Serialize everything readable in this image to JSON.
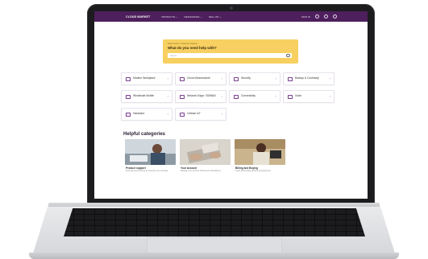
{
  "nav": {
    "brand": "CLOUD MARKET",
    "links": [
      "PRODUCTS ⌄",
      "RESOURCES ⌄",
      "SELL ON ⌄"
    ],
    "login": "SIGN IN"
  },
  "banner": {
    "crumb": "Help Center / Customer Support",
    "title": "What do you need help with?",
    "placeholder": "Search"
  },
  "categories": [
    {
      "label": "Modern Workplace"
    },
    {
      "label": "Cloud Infrastructure"
    },
    {
      "label": "Security"
    },
    {
      "label": "Backup & Continuity"
    },
    {
      "label": "Wholesale Mobile"
    },
    {
      "label": "Network Edge / SDWAN"
    },
    {
      "label": "Connectivity"
    },
    {
      "label": "Voice"
    },
    {
      "label": "Hardware"
    },
    {
      "label": "Cellular IoT"
    }
  ],
  "helpful": {
    "title": "Helpful categories",
    "items": [
      {
        "label": "Product support",
        "desc": "Find help and answers for products you purchase"
      },
      {
        "label": "Your account",
        "desc": "Manage your account, billing and subscriptions"
      },
      {
        "label": "Billing and Buying",
        "desc": "Learn about billing options and payments"
      }
    ]
  },
  "colors": {
    "nav": "#4d1f5c",
    "banner": "#f7d061",
    "accent": "#7a3d8f"
  }
}
